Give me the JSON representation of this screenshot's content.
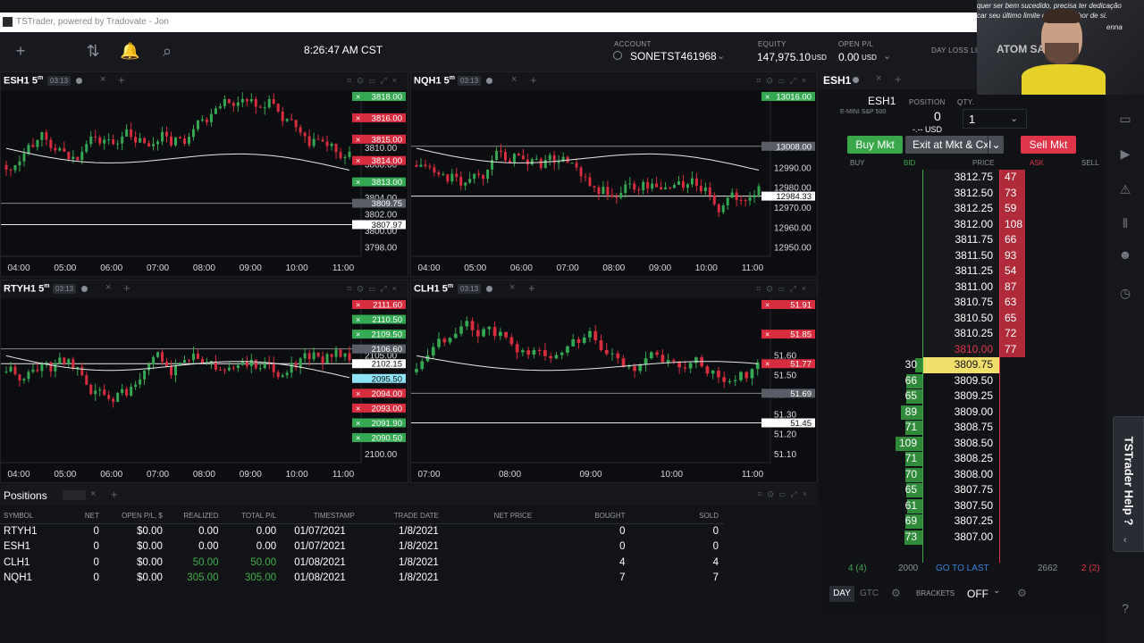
{
  "window": {
    "title": "TSTrader, powered by Tradovate - Jon"
  },
  "topbar": {
    "clock": "8:26:47 AM CST",
    "account_label": "ACCOUNT",
    "account_value": "SONETST461968",
    "equity_label": "EQUITY",
    "equity_value": "147,975.10",
    "equity_unit": "USD",
    "openpl_label": "OPEN P/L",
    "openpl_value": "0.00",
    "openpl_unit": "USD",
    "dayloss_label": "DAY LOSS LIM"
  },
  "charts": [
    {
      "symbol": "ESH1",
      "tf": "5",
      "tf_unit": "m",
      "timer": "03:13",
      "x_ticks": [
        "04:00",
        "05:00",
        "06:00",
        "07:00",
        "08:00",
        "09:00",
        "10:00",
        "11:00"
      ],
      "y_ticks": [
        "3810.00",
        "3808.00",
        "3806.00",
        "3804.00",
        "3802.00",
        "3800.00",
        "3798.00"
      ],
      "tags": [
        {
          "t": "3818.00",
          "c": "green"
        },
        {
          "t": "3816.00",
          "c": "red"
        },
        {
          "t": "3815.00",
          "c": "red"
        },
        {
          "t": "3814.00",
          "c": "red"
        },
        {
          "t": "3813.00",
          "c": "green"
        },
        {
          "t": "3809.75",
          "c": "grey"
        },
        {
          "t": "3807.97",
          "c": "white"
        }
      ]
    },
    {
      "symbol": "NQH1",
      "tf": "5",
      "tf_unit": "m",
      "timer": "03:13",
      "x_ticks": [
        "04:00",
        "05:00",
        "06:00",
        "07:00",
        "08:00",
        "09:00",
        "10:00",
        "11:00"
      ],
      "y_ticks": [
        "13000.00",
        "12990.00",
        "12980.00",
        "12970.00",
        "12960.00",
        "12950.00"
      ],
      "tags": [
        {
          "t": "13016.00",
          "c": "green"
        },
        {
          "t": "13008.00",
          "c": "grey"
        },
        {
          "t": "12984.33",
          "c": "white"
        }
      ]
    },
    {
      "symbol": "RTYH1",
      "tf": "5",
      "tf_unit": "m",
      "timer": "03:13",
      "x_ticks": [
        "04:00",
        "05:00",
        "06:00",
        "07:00",
        "08:00",
        "09:00",
        "10:00",
        "11:00"
      ],
      "y_ticks": [
        "2105.00",
        "2100.00"
      ],
      "tags": [
        {
          "t": "2111.60",
          "c": "red"
        },
        {
          "t": "2110.50",
          "c": "green"
        },
        {
          "t": "2109.50",
          "c": "green"
        },
        {
          "t": "2106.60",
          "c": "grey"
        },
        {
          "t": "2102.15",
          "c": "white"
        },
        {
          "t": "2095.50",
          "c": "cyan"
        },
        {
          "t": "2094.00",
          "c": "red"
        },
        {
          "t": "2093.00",
          "c": "red"
        },
        {
          "t": "2091.90",
          "c": "green"
        },
        {
          "t": "2090.50",
          "c": "green"
        }
      ]
    },
    {
      "symbol": "CLH1",
      "tf": "5",
      "tf_unit": "m",
      "timer": "03:13",
      "x_ticks": [
        "07:00",
        "08:00",
        "09:00",
        "10:00",
        "11:00"
      ],
      "y_ticks": [
        "51.60",
        "51.50",
        "51.40",
        "51.30",
        "51.20",
        "51.10"
      ],
      "tags": [
        {
          "t": "51.91",
          "c": "red"
        },
        {
          "t": "51.85",
          "c": "red"
        },
        {
          "t": "51.77",
          "c": "red"
        },
        {
          "t": "51.69",
          "c": "grey"
        },
        {
          "t": "51.45",
          "c": "white"
        }
      ]
    }
  ],
  "positions": {
    "title": "Positions",
    "columns": [
      "SYMBOL",
      "NET",
      "OPEN P/L, $",
      "REALIZED",
      "TOTAL P/L",
      "TIMESTAMP",
      "TRADE DATE",
      "NET PRICE",
      "BOUGHT",
      "SOLD"
    ],
    "rows": [
      {
        "symbol": "RTYH1",
        "net": "0",
        "open": "$0.00",
        "realized": "0.00",
        "total": "0.00",
        "ts": "01/07/2021",
        "date": "1/8/2021",
        "netprice": "",
        "bought": "0",
        "sold": "0",
        "pos": false
      },
      {
        "symbol": "ESH1",
        "net": "0",
        "open": "$0.00",
        "realized": "0.00",
        "total": "0.00",
        "ts": "01/07/2021",
        "date": "1/8/2021",
        "netprice": "",
        "bought": "0",
        "sold": "0",
        "pos": false
      },
      {
        "symbol": "CLH1",
        "net": "0",
        "open": "$0.00",
        "realized": "50.00",
        "total": "50.00",
        "ts": "01/08/2021",
        "date": "1/8/2021",
        "netprice": "",
        "bought": "4",
        "sold": "4",
        "pos": true
      },
      {
        "symbol": "NQH1",
        "net": "0",
        "open": "$0.00",
        "realized": "305.00",
        "total": "305.00",
        "ts": "01/08/2021",
        "date": "1/8/2021",
        "netprice": "",
        "bought": "7",
        "sold": "7",
        "pos": true
      }
    ]
  },
  "dom": {
    "tab": "ESH1",
    "symbol": "ESH1",
    "desc": "E-MINI S&P 500",
    "position_label": "POSITION",
    "position_value": "0",
    "position_pl": "-.-- USD",
    "qty_label": "QTY.",
    "qty_value": "1",
    "buy_label": "Buy Mkt",
    "exit_label": "Exit at Mkt & Cxl",
    "sell_label": "Sell Mkt",
    "headers": [
      "BUY",
      "BID",
      "PRICE",
      "ASK",
      "SELL"
    ],
    "ladder": [
      {
        "price": "3812.75",
        "bid": "",
        "ask": "47"
      },
      {
        "price": "3812.50",
        "bid": "",
        "ask": "73"
      },
      {
        "price": "3812.25",
        "bid": "",
        "ask": "59"
      },
      {
        "price": "3812.00",
        "bid": "",
        "ask": "108"
      },
      {
        "price": "3811.75",
        "bid": "",
        "ask": "66"
      },
      {
        "price": "3811.50",
        "bid": "",
        "ask": "93"
      },
      {
        "price": "3811.25",
        "bid": "",
        "ask": "54"
      },
      {
        "price": "3811.00",
        "bid": "",
        "ask": "87"
      },
      {
        "price": "3810.75",
        "bid": "",
        "ask": "63"
      },
      {
        "price": "3810.50",
        "bid": "",
        "ask": "65"
      },
      {
        "price": "3810.25",
        "bid": "",
        "ask": "72"
      },
      {
        "price": "3810.00",
        "bid": "",
        "ask": "77"
      },
      {
        "price": "3809.75",
        "bid": "30",
        "ask": "",
        "last": "1"
      },
      {
        "price": "3809.50",
        "bid": "66",
        "ask": ""
      },
      {
        "price": "3809.25",
        "bid": "65",
        "ask": ""
      },
      {
        "price": "3809.00",
        "bid": "89",
        "ask": ""
      },
      {
        "price": "3808.75",
        "bid": "71",
        "ask": ""
      },
      {
        "price": "3808.50",
        "bid": "109",
        "ask": ""
      },
      {
        "price": "3808.25",
        "bid": "71",
        "ask": ""
      },
      {
        "price": "3808.00",
        "bid": "70",
        "ask": ""
      },
      {
        "price": "3807.75",
        "bid": "65",
        "ask": ""
      },
      {
        "price": "3807.50",
        "bid": "61",
        "ask": ""
      },
      {
        "price": "3807.25",
        "bid": "69",
        "ask": ""
      },
      {
        "price": "3807.00",
        "bid": "73",
        "ask": ""
      }
    ],
    "foot": {
      "buy": "4 (4)",
      "bid": "2000",
      "goto": "GO TO LAST",
      "ask": "2662",
      "sell": "2 (2)"
    },
    "day": "DAY",
    "gtc": "GTC",
    "brackets_label": "BRACKETS",
    "brackets_value": "OFF"
  },
  "overlay": {
    "help": "TSTrader Help ?",
    "webcam_text1": "quer ser bem sucedido, precisa ter dedicação",
    "webcam_text2": "car seu último limite e dar o melhor de si.",
    "webcam_text3": "enna",
    "webcam_logo": "ATOM SA"
  }
}
